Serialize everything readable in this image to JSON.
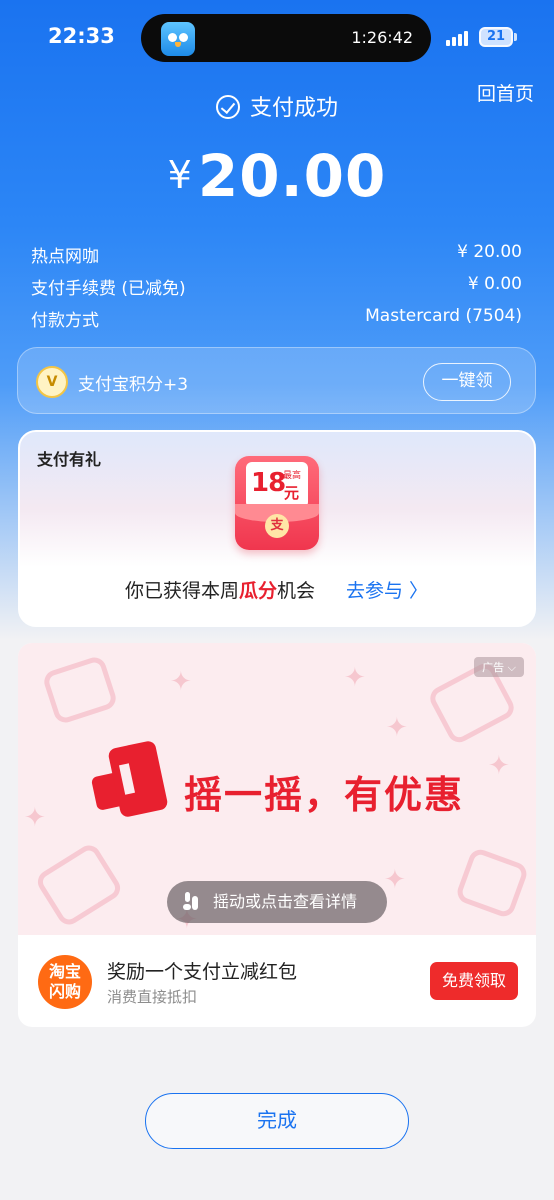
{
  "status_bar": {
    "time": "22:33",
    "live_timer": "1:26:42",
    "battery_level": "21"
  },
  "header": {
    "home_link": "回首页",
    "success_text": "支付成功",
    "currency_symbol": "¥",
    "amount": "20.00"
  },
  "details": [
    {
      "label": "热点网咖",
      "value": "¥ 20.00"
    },
    {
      "label": "支付手续费 (已减免)",
      "value": "¥ 0.00"
    },
    {
      "label": "付款方式",
      "value": "Mastercard (7504)"
    }
  ],
  "points": {
    "icon_text": "V",
    "text": "支付宝积分+3",
    "button": "一键领"
  },
  "gift": {
    "title": "支付有礼",
    "packet_amount": "18",
    "packet_prefix": "最高",
    "packet_unit": "元",
    "seal": "支",
    "message_before": "你已获得本周",
    "message_highlight": "瓜分",
    "message_after": "机会",
    "link": "去参与 〉"
  },
  "ad": {
    "tag": "广告 ⌵",
    "headline": "摇一摇，有优惠",
    "hint": "摇动或点击查看详情",
    "logo_line1": "淘宝",
    "logo_line2": "闪购",
    "title": "奖励一个支付立减红包",
    "subtitle": "消费直接抵扣",
    "button": "免费领取"
  },
  "done_button": "完成",
  "colors": {
    "brand_blue": "#1a73f0",
    "accent_red": "#e8202f",
    "ad_orange": "#ff6a13"
  }
}
